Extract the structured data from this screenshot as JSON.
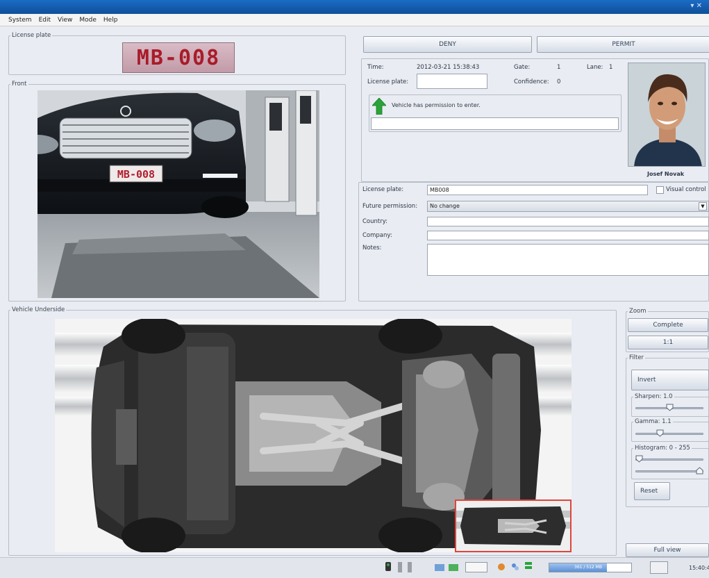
{
  "menu": [
    "System",
    "Edit",
    "View",
    "Mode",
    "Help"
  ],
  "license_panel": {
    "legend": "License plate",
    "plate_text": "MB-008"
  },
  "front_panel": {
    "legend": "Front",
    "front_plate_text": "MB-008"
  },
  "actions": {
    "deny": "DENY",
    "permit": "PERMIT"
  },
  "info": {
    "time_label": "Time:",
    "time_value": "2012-03-21 15:38:43",
    "gate_label": "Gate:",
    "gate_value": "1",
    "lane_label": "Lane:",
    "lane_value": "1",
    "plate_label": "License plate:",
    "plate_value": "",
    "confidence_label": "Confidence:",
    "confidence_value": "0",
    "message": "Vehicle has permission to enter.",
    "message_detail": "",
    "person_name": "Josef Novak"
  },
  "form": {
    "plate_label": "License plate:",
    "plate_value": "MB008",
    "visual_control_label": "Visual control",
    "future_label": "Future permission:",
    "future_value": "No change",
    "country_label": "Country:",
    "country_value": "",
    "company_label": "Company:",
    "company_value": "",
    "notes_label": "Notes:",
    "notes_value": ""
  },
  "underside": {
    "legend": "Vehicle Underside"
  },
  "zoom": {
    "legend": "Zoom",
    "complete": "Complete",
    "one_to_one": "1:1"
  },
  "filter": {
    "legend": "Filter",
    "invert": "Invert",
    "sharpen_label": "Sharpen: 1.0",
    "sharpen_level": 0.5,
    "gamma_label": "Gamma: 1.1",
    "gamma_level": 0.35,
    "histogram_label": "Histogram: 0 - 255",
    "histogram_low": 0,
    "histogram_high": 255,
    "reset": "Reset"
  },
  "full_view": "Full view",
  "status": {
    "progress_text": "361 / 512 MB",
    "clock": "15:40:4"
  },
  "colors": {
    "accent": "#1a6cc4",
    "plate_bg": "#c8a4b0",
    "plate_fg": "#b21e2c",
    "ok_green": "#2aa33a",
    "minimap_border": "#e0443c"
  },
  "icons": [
    "arrow-up-icon",
    "dropdown-chevron-icon",
    "camera-icon",
    "barrier-icon",
    "network-icon",
    "monitor-icon",
    "settings-icon",
    "lock-icon"
  ]
}
